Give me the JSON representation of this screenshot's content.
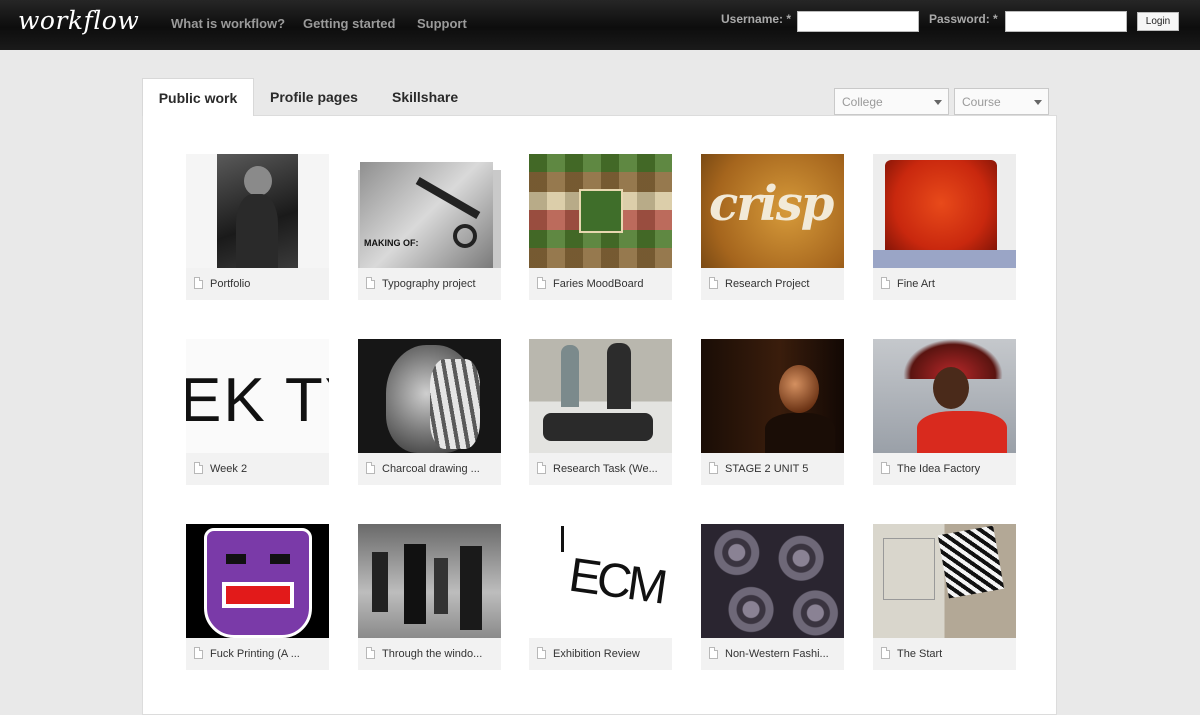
{
  "header": {
    "logo": "workflow",
    "nav": [
      "What is workflow?",
      "Getting started",
      "Support"
    ],
    "username_label": "Username: *",
    "password_label": "Password: *",
    "username_value": "",
    "password_value": "",
    "login_label": "Login"
  },
  "tabs": [
    "Public work",
    "Profile pages",
    "Skillshare"
  ],
  "filters": {
    "college": "College",
    "course": "Course"
  },
  "items": [
    "Portfolio",
    "Typography project",
    "Faries MoodBoard",
    "Research Project",
    "Fine Art",
    "Week 2",
    "Charcoal drawing ...",
    "Research Task (We...",
    "STAGE 2 UNIT 5",
    "The Idea Factory",
    "Fuck Printing (A ...",
    "Through the windo...",
    "Exhibition Review",
    "Non-Western Fashi...",
    "The Start"
  ],
  "thumbs": {
    "0": {
      "text": ""
    },
    "1": {
      "text": "MAKING OF:"
    },
    "3": {
      "text": "crisp"
    },
    "5": {
      "text": "EK TY"
    },
    "12": {
      "text": "ECM"
    }
  }
}
